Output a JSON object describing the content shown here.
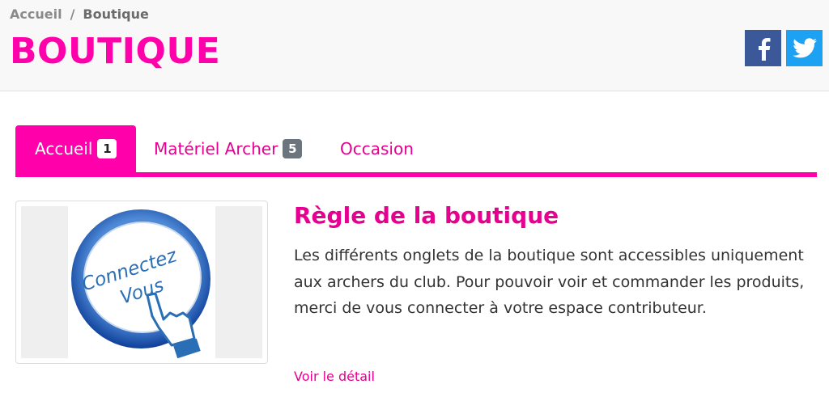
{
  "breadcrumb": {
    "home": "Accueil",
    "separator": "/",
    "current": "Boutique"
  },
  "page": {
    "title": "BOUTIQUE"
  },
  "social": {
    "facebook_icon": "facebook-icon",
    "twitter_icon": "twitter-icon"
  },
  "tabs": [
    {
      "label": "Accueil",
      "badge": "1",
      "active": true
    },
    {
      "label": "Matériel Archer",
      "badge": "5",
      "active": false
    },
    {
      "label": "Occasion",
      "badge": "",
      "active": false
    }
  ],
  "article": {
    "image_text_line1": "Connectez",
    "image_text_line2": "Vous",
    "title": "Règle de la boutique",
    "body": "Les différents onglets de la boutique sont accessibles uniquement aux archers du club. Pour pouvoir voir et commander les produits, merci de vous connecter à votre espace contributeur.",
    "read_more": "Voir le détail"
  },
  "colors": {
    "accent": "#ff00aa",
    "facebook": "#3b5998",
    "twitter": "#1da1f2",
    "badge_grey": "#6c757d"
  }
}
